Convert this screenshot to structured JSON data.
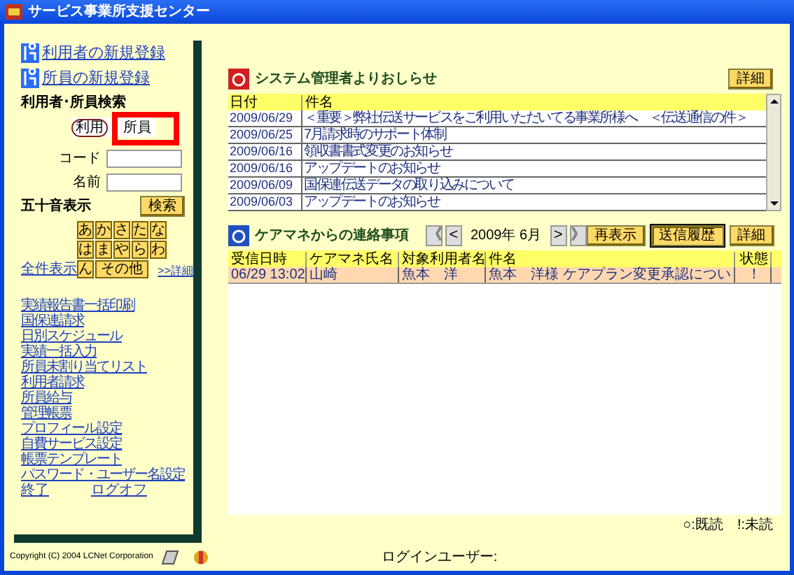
{
  "window": {
    "title": "サービス事業所支援センター"
  },
  "sidebar": {
    "register_links": [
      "利用者の新規登録",
      "所員の新規登録"
    ],
    "search_title": "利用者･所員検索",
    "target_options": [
      {
        "label": "利用",
        "selected": true
      },
      {
        "label": "所員",
        "selected": false
      }
    ],
    "fields": [
      {
        "label": "コード"
      },
      {
        "label": "名前"
      }
    ],
    "kana_title": "五十音表示",
    "search_button": "検索",
    "kana_keys": [
      "あ",
      "か",
      "さ",
      "た",
      "な",
      "は",
      "ま",
      "や",
      "ら",
      "わ",
      "ん",
      "その他"
    ],
    "show_all": "全件表示",
    "detail_link": ">>詳細",
    "menu": [
      "実績報告書一括印刷",
      "国保連請求",
      "日別スケジュール",
      "実績一括入力",
      "所員未割り当てリスト",
      "利用者請求",
      "所員給与",
      "管理帳票",
      "プロフィール設定",
      "自費サービス設定",
      "帳票テンプレート",
      "パスワード・ユーザー名設定"
    ],
    "exit": "終了",
    "logoff": "ログオフ"
  },
  "notices": {
    "title": "システム管理者よりおしらせ",
    "detail_button": "詳細",
    "columns": [
      "日付",
      "件名"
    ],
    "rows": [
      [
        "2009/06/29",
        "＜重要＞弊社伝送サービスをご利用いただいてる事業所様へ　＜伝送通信の件＞"
      ],
      [
        "2009/06/25",
        "7月請求時のサポート体制"
      ],
      [
        "2009/06/16",
        "領収書書式変更のお知らせ"
      ],
      [
        "2009/06/16",
        "アップデートのお知らせ"
      ],
      [
        "2009/06/09",
        "国保連伝送データの取り込みについて"
      ],
      [
        "2009/06/03",
        "アップデートのお知らせ"
      ]
    ]
  },
  "messages": {
    "title": "ケアマネからの連絡事項",
    "nav": [
      "《",
      "<",
      ">",
      "》"
    ],
    "month": "2009年 6月",
    "buttons": [
      {
        "label": "再表示",
        "selected": false
      },
      {
        "label": "送信履歴",
        "selected": true
      },
      {
        "label": "詳細",
        "selected": false
      }
    ],
    "columns": [
      "受信日時",
      "ケアマネ氏名",
      "対象利用者名",
      "件名",
      "状態"
    ],
    "rows": [
      [
        "06/29 13:02",
        "山崎",
        "魚本　洋",
        "魚本　洋様 ケアプラン変更承認につい",
        "！"
      ]
    ],
    "legend": "○:既読　!:未読"
  },
  "status_bar": {
    "copyright": "Copyright (C) 2004 LCNet Corporation",
    "login_user": "ログインユーザー:"
  }
}
